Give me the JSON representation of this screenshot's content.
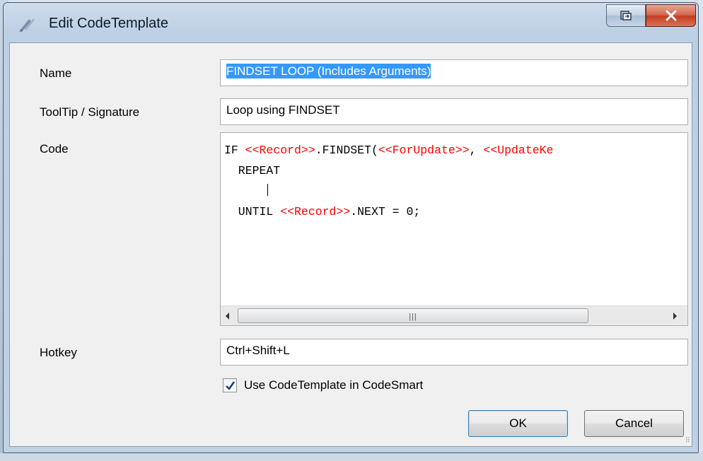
{
  "window": {
    "title": "Edit CodeTemplate"
  },
  "form": {
    "name_label": "Name",
    "name_value": "FINDSET LOOP (Includes Arguments)",
    "tooltip_label": "ToolTip / Signature",
    "tooltip_value": "Loop using FINDSET",
    "code_label": "Code",
    "code_lines": [
      [
        {
          "t": "IF ",
          "c": "plain"
        },
        {
          "t": "<<Record>>",
          "c": "red"
        },
        {
          "t": ".FINDSET(",
          "c": "plain"
        },
        {
          "t": "<<ForUpdate>>",
          "c": "red"
        },
        {
          "t": ", ",
          "c": "plain"
        },
        {
          "t": "<<UpdateKe",
          "c": "red"
        }
      ],
      [
        {
          "t": "  REPEAT",
          "c": "plain"
        }
      ],
      [
        {
          "t": "",
          "c": "plain"
        }
      ],
      [
        {
          "t": "  UNTIL ",
          "c": "plain"
        },
        {
          "t": "<<Record>>",
          "c": "red"
        },
        {
          "t": ".NEXT = 0;",
          "c": "plain"
        }
      ]
    ],
    "hotkey_label": "Hotkey",
    "hotkey_value": "Ctrl+Shift+L",
    "use_in_codesmart_label": "Use CodeTemplate in CodeSmart",
    "use_in_codesmart_checked": true
  },
  "buttons": {
    "ok_label": "OK",
    "cancel_label": "Cancel"
  },
  "colors": {
    "code_placeholder": "#ff0000",
    "selection": "#3399ff",
    "close_button": "#c8452b"
  },
  "icons": [
    "app-icon",
    "restore-icon",
    "close-icon",
    "checkmark-icon",
    "scroll-left-icon",
    "scroll-right-icon",
    "resize-grip-icon"
  ]
}
